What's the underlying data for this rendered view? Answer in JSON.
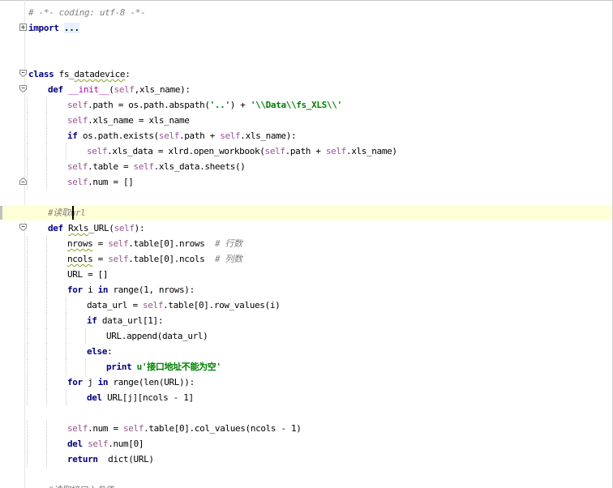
{
  "editor": {
    "language": "python",
    "current_line_index": 13,
    "colors": {
      "keyword": "#000080",
      "self": "#94558d",
      "string": "#008000",
      "comment": "#808080",
      "magic_method": "#b200b2",
      "current_line_bg": "#ffffd7",
      "squiggle": "#8aa326"
    },
    "lines": [
      {
        "indent": 0,
        "fold": "",
        "tokens": [
          {
            "t": "cmt",
            "v": "# -*- coding: utf-8 -*-"
          }
        ]
      },
      {
        "indent": 0,
        "fold": "plus",
        "tokens": [
          {
            "t": "kw",
            "v": "import"
          },
          {
            "t": "plain",
            "v": " "
          },
          {
            "t": "foldbox",
            "v": "..."
          }
        ]
      },
      {
        "indent": 0,
        "fold": "",
        "tokens": []
      },
      {
        "indent": 0,
        "fold": "",
        "tokens": []
      },
      {
        "indent": 0,
        "fold": "open",
        "tokens": [
          {
            "t": "kw",
            "v": "class"
          },
          {
            "t": "plain",
            "v": " fs_"
          },
          {
            "t": "sq",
            "v": "datadevice"
          },
          {
            "t": "plain",
            "v": ":"
          }
        ]
      },
      {
        "indent": 1,
        "fold": "open",
        "tokens": [
          {
            "t": "kw",
            "v": "def"
          },
          {
            "t": "plain",
            "v": " "
          },
          {
            "t": "magic",
            "v": "__init__"
          },
          {
            "t": "plain",
            "v": "("
          },
          {
            "t": "self",
            "v": "self"
          },
          {
            "t": "plain",
            "v": ",xls_name):"
          }
        ]
      },
      {
        "indent": 2,
        "fold": "",
        "tokens": [
          {
            "t": "self",
            "v": "self"
          },
          {
            "t": "plain",
            "v": ".path = os.path.abspath("
          },
          {
            "t": "str",
            "v": "'..'"
          },
          {
            "t": "plain",
            "v": ") + "
          },
          {
            "t": "str",
            "v": "'\\\\Data\\\\fs_XLS\\\\'"
          }
        ]
      },
      {
        "indent": 2,
        "fold": "",
        "tokens": [
          {
            "t": "self",
            "v": "self"
          },
          {
            "t": "plain",
            "v": ".xls_name = xls_name"
          }
        ]
      },
      {
        "indent": 2,
        "fold": "",
        "tokens": [
          {
            "t": "kw",
            "v": "if"
          },
          {
            "t": "plain",
            "v": " os.path.exists("
          },
          {
            "t": "self",
            "v": "self"
          },
          {
            "t": "plain",
            "v": ".path + "
          },
          {
            "t": "self",
            "v": "self"
          },
          {
            "t": "plain",
            "v": ".xls_name):"
          }
        ]
      },
      {
        "indent": 3,
        "fold": "",
        "tokens": [
          {
            "t": "self",
            "v": "self"
          },
          {
            "t": "plain",
            "v": ".xls_data = xlrd.open_workbook("
          },
          {
            "t": "self",
            "v": "self"
          },
          {
            "t": "plain",
            "v": ".path + "
          },
          {
            "t": "self",
            "v": "self"
          },
          {
            "t": "plain",
            "v": ".xls_name)"
          }
        ]
      },
      {
        "indent": 2,
        "fold": "",
        "tokens": [
          {
            "t": "self",
            "v": "self"
          },
          {
            "t": "plain",
            "v": ".table = "
          },
          {
            "t": "self",
            "v": "self"
          },
          {
            "t": "plain",
            "v": ".xls_data.sheets()"
          }
        ]
      },
      {
        "indent": 2,
        "fold": "close",
        "tokens": [
          {
            "t": "self",
            "v": "self"
          },
          {
            "t": "plain",
            "v": ".num = []"
          }
        ]
      },
      {
        "indent": 0,
        "fold": "",
        "tokens": []
      },
      {
        "indent": 1,
        "fold": "",
        "tokens": [
          {
            "t": "cmt",
            "v": "#读取url"
          }
        ]
      },
      {
        "indent": 1,
        "fold": "open",
        "tokens": [
          {
            "t": "kw",
            "v": "def"
          },
          {
            "t": "plain",
            "v": " "
          },
          {
            "t": "sq",
            "v": "Rxls"
          },
          {
            "t": "plain",
            "v": "_URL("
          },
          {
            "t": "self",
            "v": "self"
          },
          {
            "t": "plain",
            "v": "):"
          }
        ]
      },
      {
        "indent": 2,
        "fold": "",
        "tokens": [
          {
            "t": "sq",
            "v": "nrows"
          },
          {
            "t": "plain",
            "v": " = "
          },
          {
            "t": "self",
            "v": "self"
          },
          {
            "t": "plain",
            "v": ".table[0].nrows  "
          },
          {
            "t": "cmt",
            "v": "# 行数"
          }
        ]
      },
      {
        "indent": 2,
        "fold": "",
        "tokens": [
          {
            "t": "sq",
            "v": "ncols"
          },
          {
            "t": "plain",
            "v": " = "
          },
          {
            "t": "self",
            "v": "self"
          },
          {
            "t": "plain",
            "v": ".table[0].ncols  "
          },
          {
            "t": "cmt",
            "v": "# 列数"
          }
        ]
      },
      {
        "indent": 2,
        "fold": "",
        "tokens": [
          {
            "t": "plain",
            "v": "URL = []"
          }
        ]
      },
      {
        "indent": 2,
        "fold": "",
        "tokens": [
          {
            "t": "kw",
            "v": "for"
          },
          {
            "t": "plain",
            "v": " i "
          },
          {
            "t": "kw",
            "v": "in"
          },
          {
            "t": "plain",
            "v": " range(1, nrows):"
          }
        ]
      },
      {
        "indent": 3,
        "fold": "",
        "tokens": [
          {
            "t": "plain",
            "v": "data_url = "
          },
          {
            "t": "self",
            "v": "self"
          },
          {
            "t": "plain",
            "v": ".table[0].row_values(i)"
          }
        ]
      },
      {
        "indent": 3,
        "fold": "",
        "tokens": [
          {
            "t": "kw",
            "v": "if"
          },
          {
            "t": "plain",
            "v": " data_url[1]:"
          }
        ]
      },
      {
        "indent": 4,
        "fold": "",
        "tokens": [
          {
            "t": "plain",
            "v": "URL.append(data_url)"
          }
        ]
      },
      {
        "indent": 3,
        "fold": "",
        "tokens": [
          {
            "t": "kw",
            "v": "else"
          },
          {
            "t": "plain",
            "v": ":"
          }
        ]
      },
      {
        "indent": 4,
        "fold": "",
        "tokens": [
          {
            "t": "kw",
            "v": "print"
          },
          {
            "t": "plain",
            "v": " "
          },
          {
            "t": "str",
            "v": "u'接口地址不能为空'"
          }
        ]
      },
      {
        "indent": 2,
        "fold": "",
        "tokens": [
          {
            "t": "kw",
            "v": "for"
          },
          {
            "t": "plain",
            "v": " j "
          },
          {
            "t": "kw",
            "v": "in"
          },
          {
            "t": "plain",
            "v": " range(len(URL)):"
          }
        ]
      },
      {
        "indent": 3,
        "fold": "",
        "tokens": [
          {
            "t": "kw",
            "v": "del"
          },
          {
            "t": "plain",
            "v": " URL[j][ncols - 1]"
          }
        ]
      },
      {
        "indent": 0,
        "fold": "",
        "tokens": []
      },
      {
        "indent": 2,
        "fold": "",
        "tokens": [
          {
            "t": "self",
            "v": "self"
          },
          {
            "t": "plain",
            "v": ".num = "
          },
          {
            "t": "self",
            "v": "self"
          },
          {
            "t": "plain",
            "v": ".table[0].col_values(ncols - 1)"
          }
        ]
      },
      {
        "indent": 2,
        "fold": "",
        "tokens": [
          {
            "t": "kw",
            "v": "del"
          },
          {
            "t": "plain",
            "v": " "
          },
          {
            "t": "self",
            "v": "self"
          },
          {
            "t": "plain",
            "v": ".num[0]"
          }
        ]
      },
      {
        "indent": 2,
        "fold": "",
        "tokens": [
          {
            "t": "kw",
            "v": "return"
          },
          {
            "t": "plain",
            "v": "  dict(URL)"
          }
        ]
      },
      {
        "indent": 0,
        "fold": "",
        "tokens": []
      },
      {
        "indent": 1,
        "fold": "",
        "tokens": [
          {
            "t": "cmt",
            "v": "#读取接口入参值"
          }
        ]
      }
    ]
  }
}
